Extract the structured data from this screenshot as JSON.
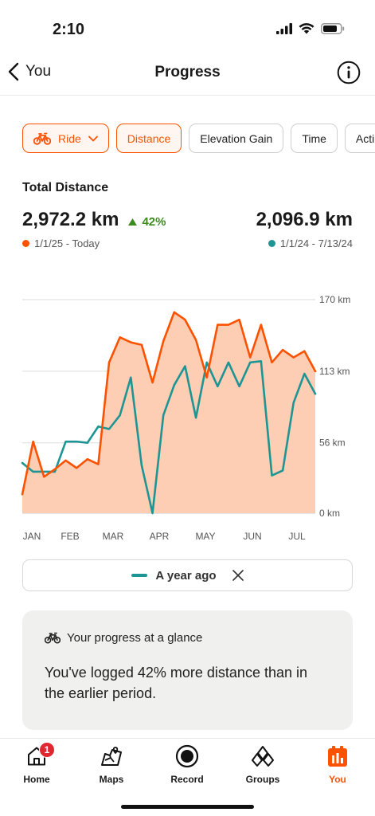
{
  "status_bar": {
    "time": "2:10"
  },
  "nav": {
    "back_label": "You",
    "title": "Progress"
  },
  "filters": [
    {
      "label": "Ride",
      "active": true
    },
    {
      "label": "Distance",
      "active": true
    },
    {
      "label": "Elevation Gain",
      "active": false
    },
    {
      "label": "Time",
      "active": false
    },
    {
      "label": "Acti",
      "active": false
    }
  ],
  "summary": {
    "title": "Total Distance",
    "current_value": "2,972.2 km",
    "change": "42%",
    "current_range": "1/1/25 - Today",
    "previous_value": "2,096.9 km",
    "previous_range": "1/1/24 - 7/13/24"
  },
  "colors": {
    "current": "#fc5200",
    "previous": "#1e9595",
    "fill": "#fdcdb4",
    "positive": "#3d8b1f"
  },
  "chart_data": {
    "type": "area",
    "y_ticks": [
      "170 km",
      "113 km",
      "56 km",
      "0 km"
    ],
    "y_tick_values": [
      170,
      113,
      56,
      0
    ],
    "ylim": [
      0,
      170
    ],
    "x_ticks": [
      "JAN",
      "FEB",
      "MAR",
      "APR",
      "MAY",
      "JUN",
      "JUL"
    ],
    "x": [
      1,
      2,
      3,
      4,
      5,
      6,
      7,
      8,
      9,
      10,
      11,
      12,
      13,
      14,
      15,
      16,
      17,
      18,
      19,
      20,
      21,
      22,
      23,
      24,
      25,
      26,
      27,
      28
    ],
    "grid": true,
    "series": [
      {
        "values": [
          15,
          57,
          29,
          35,
          42,
          36,
          43,
          39,
          120,
          140,
          136,
          134,
          104,
          137,
          160,
          154,
          138,
          108,
          150,
          150,
          154,
          124,
          150,
          120,
          130,
          124,
          129,
          113
        ]
      },
      {
        "name": "A year ago",
        "values": [
          40,
          33,
          33,
          33,
          57,
          57,
          56,
          69,
          67,
          78,
          108,
          38,
          0,
          78,
          102,
          117,
          76,
          120,
          101,
          120,
          101,
          120,
          121,
          30,
          34,
          88,
          111,
          95
        ]
      }
    ]
  },
  "legend": {
    "label": "A year ago"
  },
  "insight": {
    "heading": "Your progress at a glance",
    "body": "You've logged 42% more distance than in the earlier period."
  },
  "tabs": [
    {
      "label": "Home",
      "badge": "1",
      "icon": "home-icon"
    },
    {
      "label": "Maps",
      "icon": "map-icon"
    },
    {
      "label": "Record",
      "icon": "record-icon"
    },
    {
      "label": "Groups",
      "icon": "groups-icon"
    },
    {
      "label": "You",
      "icon": "you-icon",
      "active": true
    }
  ]
}
